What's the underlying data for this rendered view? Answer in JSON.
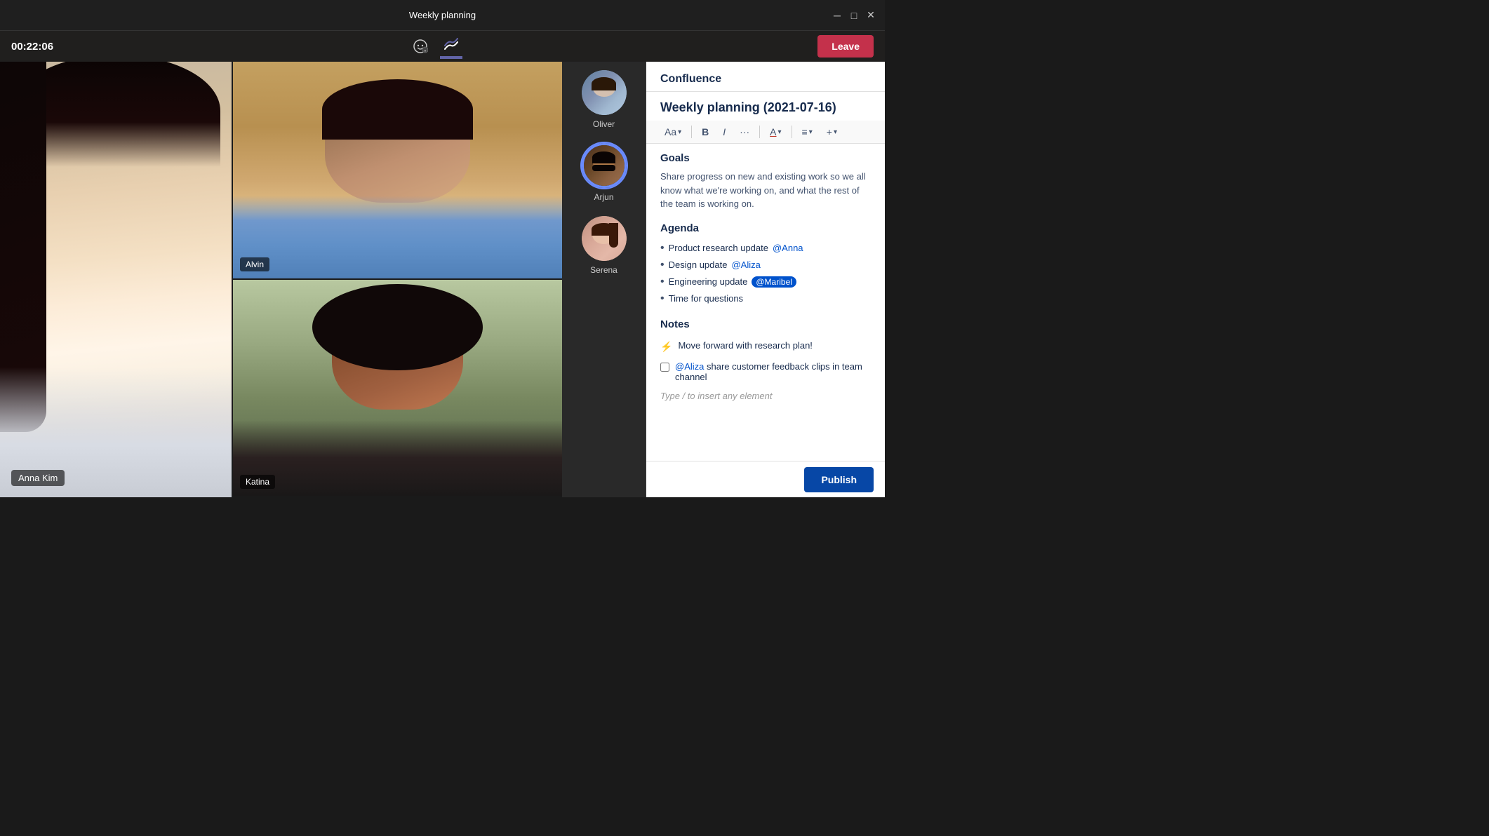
{
  "window": {
    "title": "Weekly planning",
    "controls": {
      "minimize": "─",
      "maximize": "□",
      "close": "✕"
    }
  },
  "topBar": {
    "timer": "00:22:06",
    "icons": {
      "emoji": "😊",
      "confluence": "✦"
    },
    "leaveButton": "Leave"
  },
  "participants": [
    {
      "name": "Oliver",
      "avatarType": "oliver",
      "active": false
    },
    {
      "name": "Arjun",
      "avatarType": "arjun",
      "active": true
    },
    {
      "name": "Serena",
      "avatarType": "serena",
      "active": false
    }
  ],
  "videos": {
    "large": {
      "name": "Anna Kim"
    },
    "grid": [
      {
        "name": "Alvin"
      },
      {
        "name": "Katina"
      }
    ]
  },
  "confluence": {
    "appTitle": "Confluence",
    "docTitle": "Weekly planning (2021-07-16)",
    "toolbar": {
      "fontLabel": "Aa",
      "bold": "B",
      "italic": "I",
      "more": "···",
      "color": "A",
      "list": "≡",
      "insert": "+"
    },
    "goals": {
      "title": "Goals",
      "text": "Share progress on new and existing work so we all know what we're working on, and what the rest of the team is working on."
    },
    "agenda": {
      "title": "Agenda",
      "items": [
        {
          "text": "Product research update ",
          "mention": "@Anna",
          "highlight": false
        },
        {
          "text": "Design update ",
          "mention": "@Aliza",
          "highlight": false
        },
        {
          "text": "Engineering update ",
          "mention": "@Maribel",
          "highlight": true
        },
        {
          "text": "Time for questions",
          "mention": "",
          "highlight": false
        }
      ]
    },
    "notes": {
      "title": "Notes",
      "items": [
        {
          "type": "icon",
          "icon": "⚡",
          "text": "Move forward with research plan!"
        },
        {
          "type": "checkbox",
          "checked": false,
          "text": "@Aliza  share customer feedback clips in team channel"
        }
      ],
      "placeholder": "Type / to insert any element"
    },
    "publishButton": "Publish"
  }
}
